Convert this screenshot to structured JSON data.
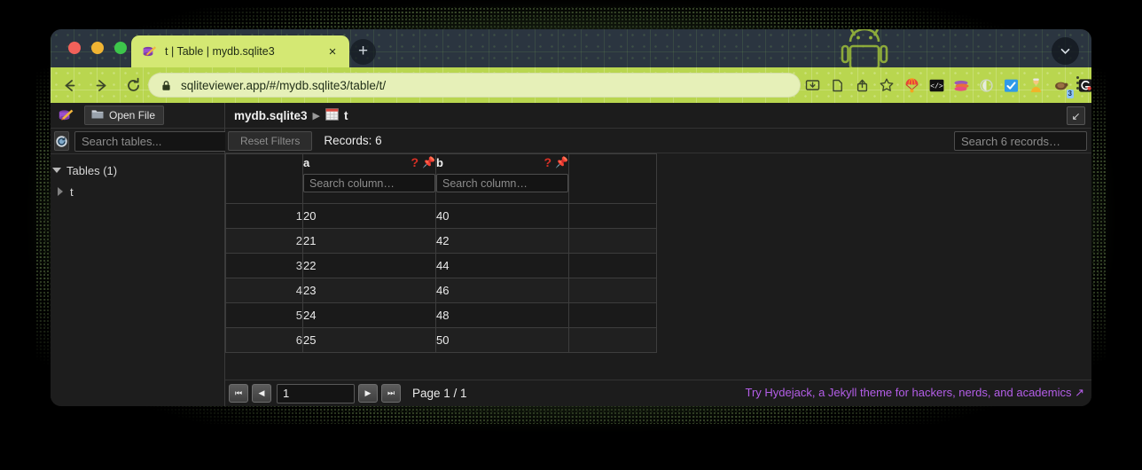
{
  "browser": {
    "tab": {
      "title": "t | Table | mydb.sqlite3",
      "favicon_name": "sqlite-logo-icon",
      "close_label": "×"
    },
    "new_tab_label": "+",
    "tab_list_chevron_name": "chevron-down-icon",
    "nav": {
      "back_name": "back-arrow-icon",
      "forward_name": "forward-arrow-icon",
      "reload_name": "reload-icon"
    },
    "omnibox": {
      "url": "sqliteviewer.app/#/mydb.sqlite3/table/t/",
      "lock_name": "lock-icon"
    },
    "omnibox_actions": [
      {
        "name": "install-app-icon",
        "glyph": "⤓"
      },
      {
        "name": "page-copy-icon",
        "glyph": "❐"
      },
      {
        "name": "share-icon",
        "glyph": "⇧"
      },
      {
        "name": "bookmark-star-icon",
        "glyph": "☆"
      }
    ],
    "extensions": [
      {
        "name": "extension-parachute-icon",
        "glyph": "🪂",
        "badge": ""
      },
      {
        "name": "extension-code-icon",
        "glyph": "</>",
        "badge": ""
      },
      {
        "name": "extension-colorful-icon",
        "glyph": "🐟",
        "badge": ""
      },
      {
        "name": "extension-ghost-icon",
        "glyph": "○",
        "badge": ""
      },
      {
        "name": "extension-checkmark-icon",
        "glyph": "✔",
        "badge": ""
      },
      {
        "name": "extension-person-icon",
        "glyph": "👷",
        "badge": ""
      },
      {
        "name": "extension-turtle-icon",
        "glyph": "🐢",
        "badge": "3"
      },
      {
        "name": "extension-grammarly-icon",
        "glyph": "G",
        "badge": ""
      },
      {
        "name": "extension-puzzle-icon",
        "glyph": "❖",
        "badge": ""
      },
      {
        "name": "side-panel-icon",
        "glyph": "▣",
        "badge": ""
      }
    ],
    "profile_avatar_name": "profile-avatar",
    "menu_name": "browser-menu-icon"
  },
  "app": {
    "sidebar": {
      "logo_name": "sqlite-viewer-logo",
      "open_file_label": "Open File",
      "open_file_icon_name": "folder-icon",
      "reload_icon_name": "refresh-database-icon",
      "table_search_placeholder": "Search tables...",
      "table_search_value": "",
      "tree": {
        "group_label": "Tables (1)",
        "items": [
          {
            "label": "t"
          }
        ]
      }
    },
    "breadcrumb": {
      "database": "mydb.sqlite3",
      "separator": "▶",
      "table": "t",
      "table_icon_name": "table-icon"
    },
    "collapse_button_glyph": "↙",
    "toolbar": {
      "reset_filters_label": "Reset Filters",
      "records_label": "Records: 6",
      "records_search_placeholder": "Search 6 records…",
      "records_search_value": ""
    },
    "grid": {
      "columns": [
        {
          "key": "rownum",
          "label": "",
          "type": "rownum"
        },
        {
          "key": "a",
          "label": "a",
          "type": "data",
          "search_placeholder": "Search column…",
          "search_value": "",
          "help_glyph": "?",
          "pin_glyph": "📌"
        },
        {
          "key": "b",
          "label": "b",
          "type": "data",
          "search_placeholder": "Search column…",
          "search_value": "",
          "help_glyph": "?",
          "pin_glyph": "📌"
        },
        {
          "key": "blank",
          "label": "",
          "type": "blank"
        }
      ],
      "rows": [
        {
          "n": "1",
          "a": "20",
          "b": "40"
        },
        {
          "n": "2",
          "a": "21",
          "b": "42"
        },
        {
          "n": "3",
          "a": "22",
          "b": "44"
        },
        {
          "n": "4",
          "a": "23",
          "b": "46"
        },
        {
          "n": "5",
          "a": "24",
          "b": "48"
        },
        {
          "n": "6",
          "a": "25",
          "b": "50"
        }
      ]
    },
    "footer": {
      "first_page_glyph": "⏮",
      "prev_page_glyph": "◀",
      "page_input_value": "1",
      "next_page_glyph": "▶",
      "last_page_glyph": "⏭",
      "page_label": "Page 1 / 1",
      "promo_text": "Try Hydejack, a Jekyll theme for hackers, nerds, and academics ↗"
    }
  },
  "colors": {
    "browser_accent": "#b9d64f",
    "tab_active": "#d4e873",
    "app_background": "#1c1c1c",
    "promo_link": "#b45ee8",
    "warning": "#d93025"
  }
}
